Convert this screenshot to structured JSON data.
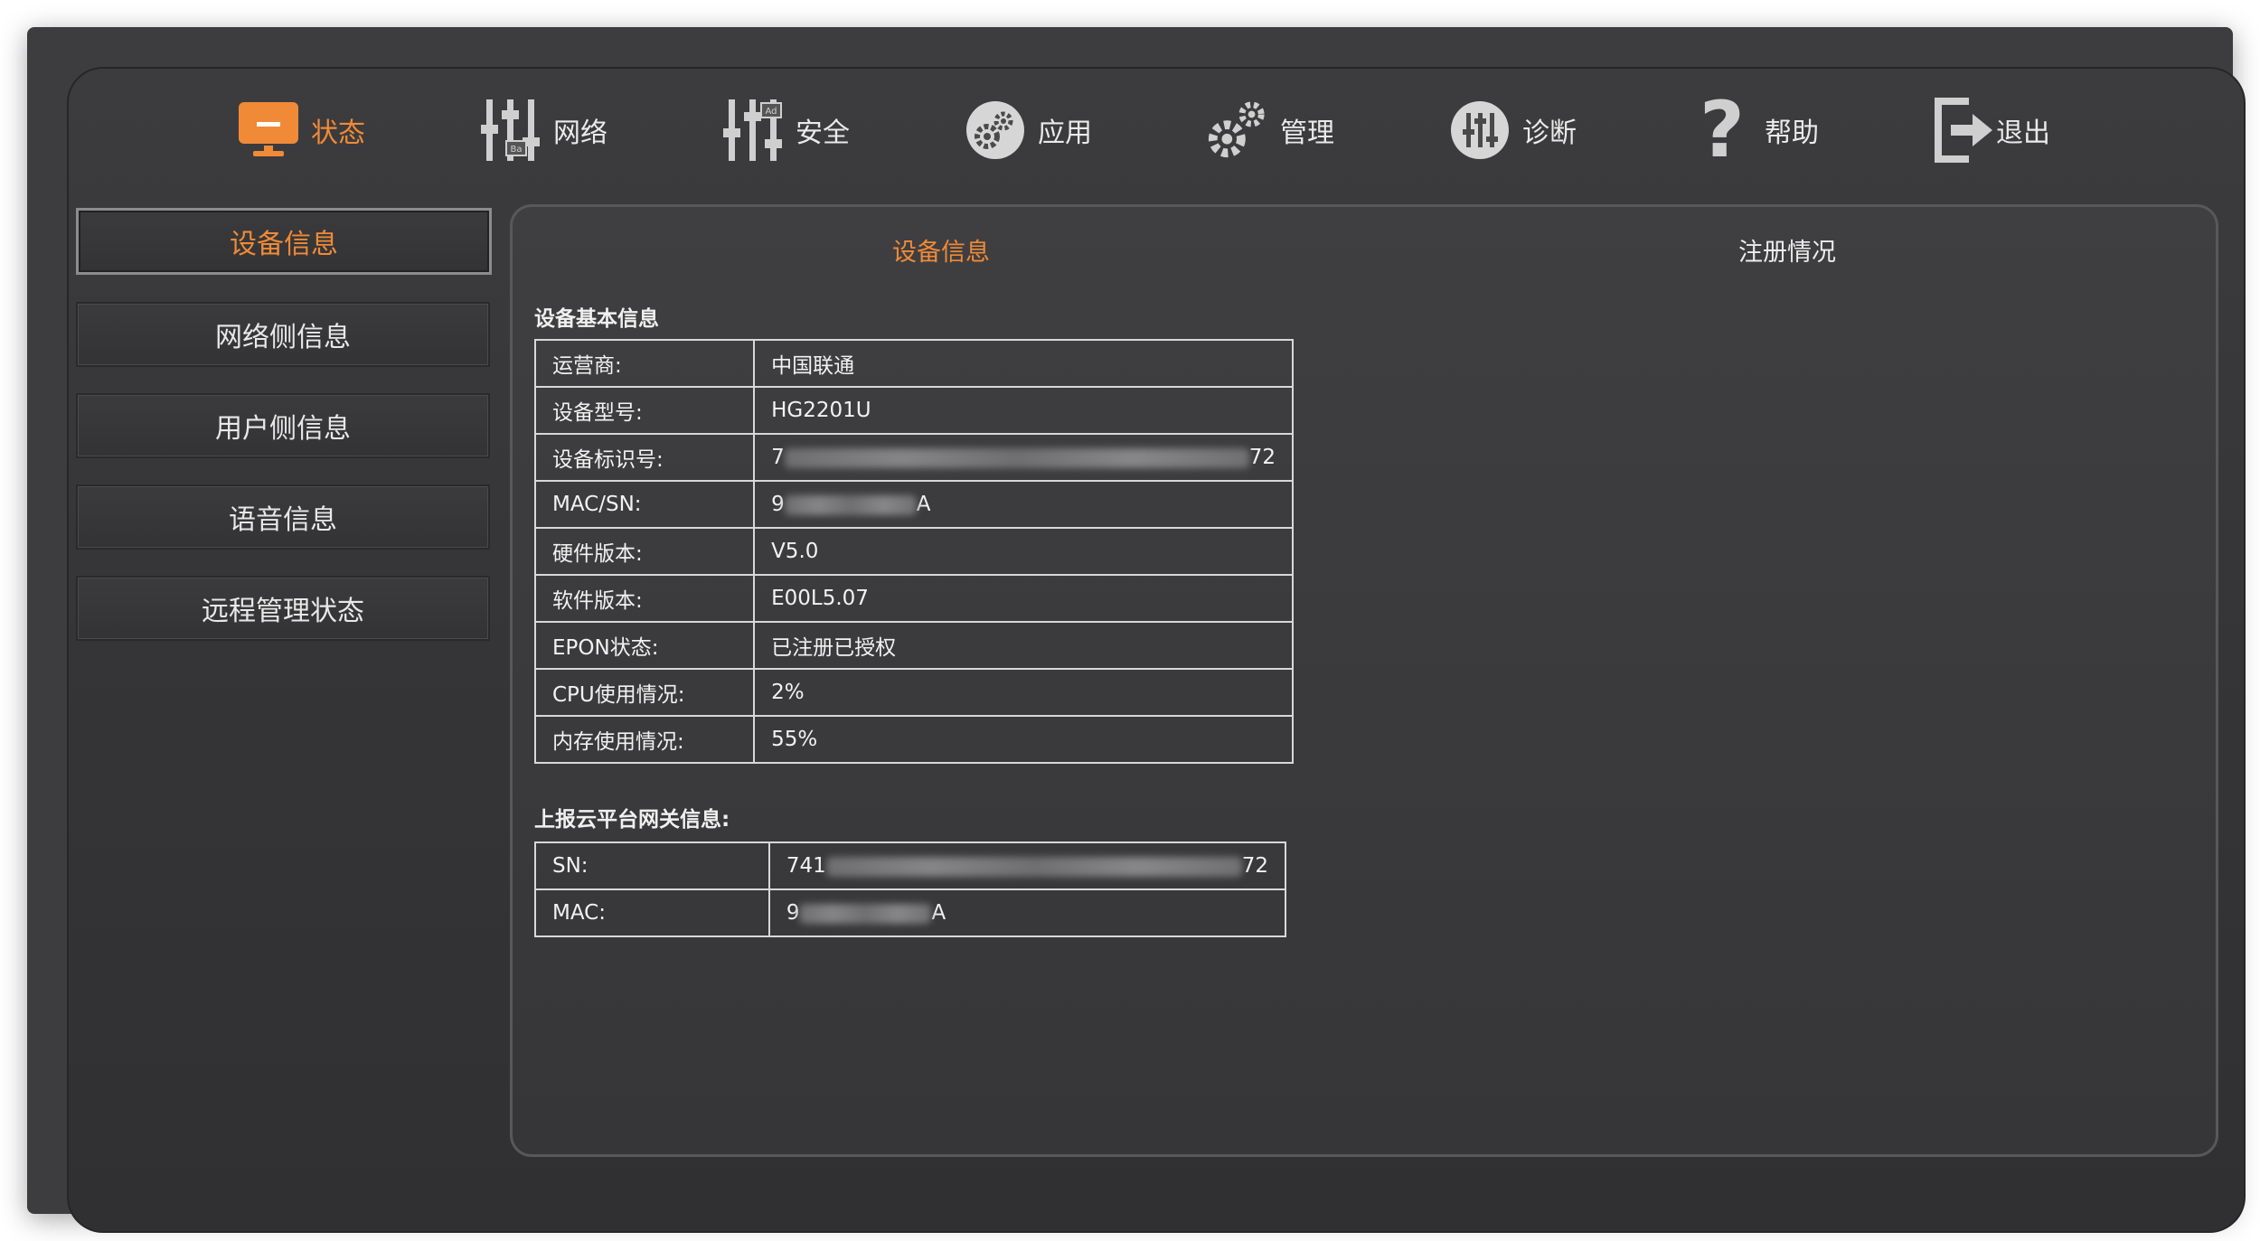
{
  "nav": {
    "items": [
      {
        "label": "状态",
        "icon": "monitor-icon",
        "active": true
      },
      {
        "label": "网络",
        "icon": "network-sliders-icon"
      },
      {
        "label": "安全",
        "icon": "security-sliders-icon"
      },
      {
        "label": "应用",
        "icon": "application-gears-icon"
      },
      {
        "label": "管理",
        "icon": "management-gears-icon"
      },
      {
        "label": "诊断",
        "icon": "diagnostics-icon"
      },
      {
        "label": "帮助",
        "icon": "question-mark-icon"
      },
      {
        "label": "退出",
        "icon": "logout-icon"
      }
    ]
  },
  "sidebar": {
    "items": [
      {
        "label": "设备信息",
        "active": true
      },
      {
        "label": "网络侧信息"
      },
      {
        "label": "用户侧信息"
      },
      {
        "label": "语音信息"
      },
      {
        "label": "远程管理状态"
      }
    ]
  },
  "tabs": [
    {
      "label": "设备信息",
      "active": true
    },
    {
      "label": "注册情况"
    }
  ],
  "basic_info": {
    "title": "设备基本信息",
    "rows": [
      {
        "key": "运营商:",
        "value": "中国联通"
      },
      {
        "key": "设备型号:",
        "value": "HG2201U"
      },
      {
        "key": "设备标识号:",
        "prefix": "7",
        "suffix": "72",
        "redacted": true
      },
      {
        "key": "MAC/SN:",
        "prefix": "9",
        "suffix": "A",
        "redacted": true
      },
      {
        "key": "硬件版本:",
        "value": "V5.0"
      },
      {
        "key": "软件版本:",
        "value": "E00L5.07"
      },
      {
        "key": "EPON状态:",
        "value": "已注册已授权"
      },
      {
        "key": "CPU使用情况:",
        "value": "2%"
      },
      {
        "key": "内存使用情况:",
        "value": "55%"
      }
    ]
  },
  "cloud_info": {
    "title": "上报云平台网关信息:",
    "rows": [
      {
        "key": "SN:",
        "prefix": "741",
        "suffix": "72",
        "redacted": true
      },
      {
        "key": "MAC:",
        "prefix": "9",
        "suffix": "A",
        "redacted": true
      }
    ]
  },
  "colors": {
    "accent": "#f08a37",
    "background": "#3d3d3f",
    "text": "#eaeaea",
    "table_border": "#d8d8d8"
  }
}
